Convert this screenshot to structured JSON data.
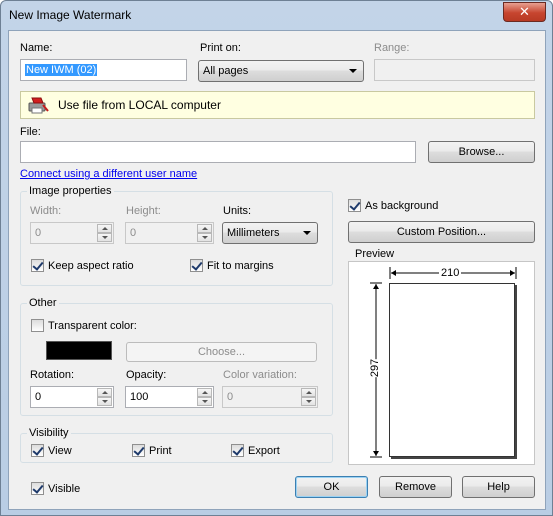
{
  "window": {
    "title": "New Image Watermark",
    "close_glyph": "✕"
  },
  "name": {
    "label": "Name:",
    "value": "New IWM (02)"
  },
  "print_on": {
    "label": "Print on:",
    "selected": "All pages"
  },
  "range": {
    "label": "Range:",
    "value": ""
  },
  "banner": {
    "text": "Use file from LOCAL computer",
    "icon": "pdf-printer-icon"
  },
  "file": {
    "label": "File:",
    "value": "",
    "browse_label": "Browse...",
    "link": "Connect using a different user name"
  },
  "image_properties": {
    "title": "Image properties",
    "width_label": "Width:",
    "width_value": "0",
    "height_label": "Height:",
    "height_value": "0",
    "units_label": "Units:",
    "units_selected": "Millimeters",
    "keep_aspect_label": "Keep aspect ratio",
    "keep_aspect_checked": true,
    "fit_margins_label": "Fit to margins",
    "fit_margins_checked": true
  },
  "other": {
    "title": "Other",
    "transparent_label": "Transparent color:",
    "transparent_checked": false,
    "color_swatch": "#000000",
    "choose_label": "Choose...",
    "rotation_label": "Rotation:",
    "rotation_value": "0",
    "opacity_label": "Opacity:",
    "opacity_value": "100",
    "variation_label": "Color variation:",
    "variation_value": "0"
  },
  "visibility": {
    "title": "Visibility",
    "view_label": "View",
    "view_checked": true,
    "print_label": "Print",
    "print_checked": true,
    "export_label": "Export",
    "export_checked": true
  },
  "as_background": {
    "label": "As background",
    "checked": true
  },
  "custom_position_label": "Custom Position...",
  "preview": {
    "title": "Preview",
    "width_dim": "210",
    "height_dim": "297"
  },
  "visible": {
    "label": "Visible",
    "checked": true
  },
  "buttons": {
    "ok": "OK",
    "remove": "Remove",
    "help": "Help"
  }
}
